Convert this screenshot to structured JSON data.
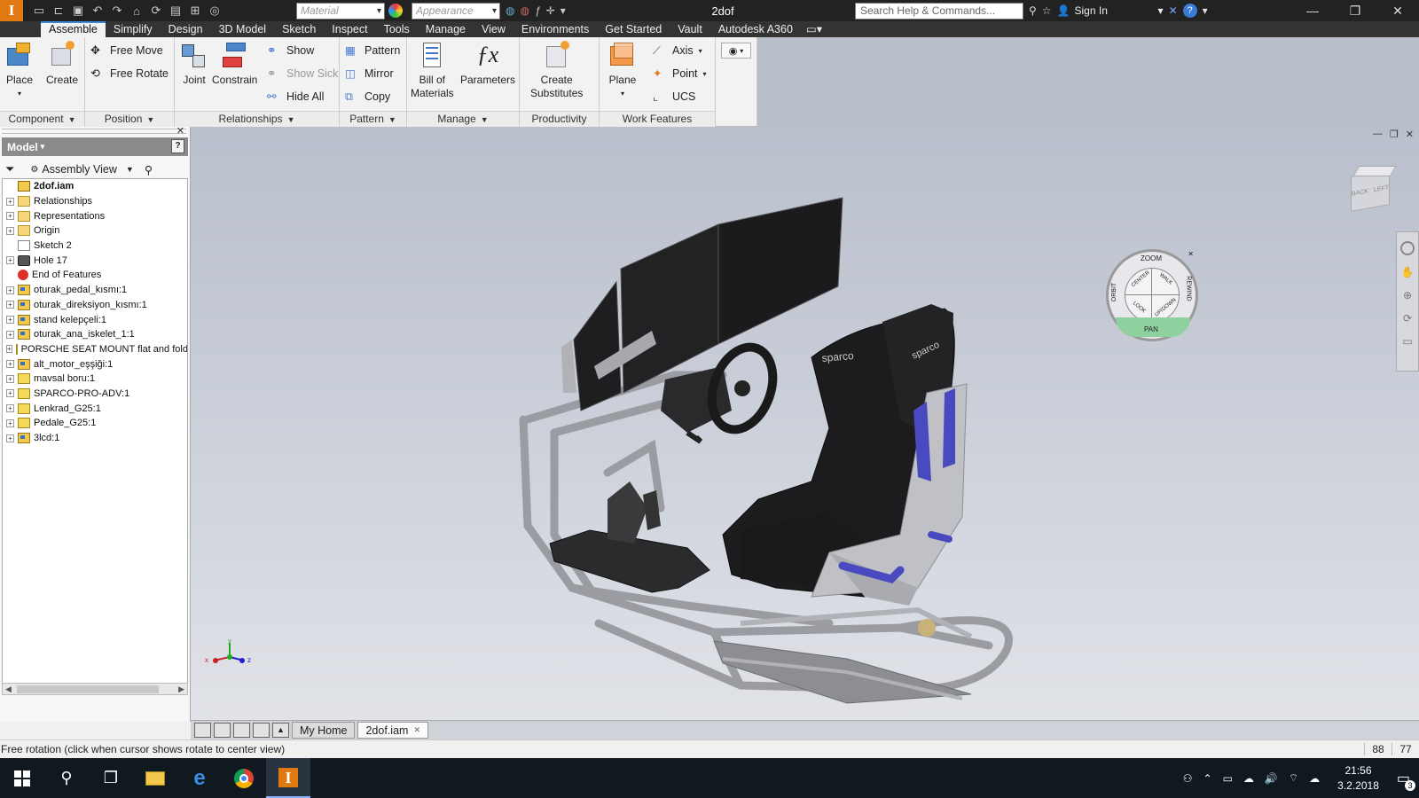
{
  "titlebar": {
    "app_letter": "I",
    "material_placeholder": "Material",
    "appearance_placeholder": "Appearance",
    "doc_title": "2dof",
    "search_placeholder": "Search Help & Commands...",
    "sign_in": "Sign In"
  },
  "ribbon": {
    "tabs": [
      "Assemble",
      "Simplify",
      "Design",
      "3D Model",
      "Sketch",
      "Inspect",
      "Tools",
      "Manage",
      "View",
      "Environments",
      "Get Started",
      "Vault",
      "Autodesk A360"
    ],
    "component": {
      "place": "Place",
      "create": "Create",
      "label": "Component"
    },
    "position": {
      "free_move": "Free Move",
      "free_rotate": "Free Rotate",
      "label": "Position"
    },
    "relationships": {
      "joint": "Joint",
      "constrain": "Constrain",
      "show": "Show",
      "show_sick": "Show Sick",
      "hide_all": "Hide All",
      "label": "Relationships"
    },
    "pattern": {
      "pattern": "Pattern",
      "mirror": "Mirror",
      "copy": "Copy",
      "label": "Pattern"
    },
    "manage": {
      "bom_line1": "Bill of",
      "bom_line2": "Materials",
      "parameters": "Parameters",
      "label": "Manage"
    },
    "productivity": {
      "create_line1": "Create",
      "create_line2": "Substitutes",
      "label": "Productivity"
    },
    "work_features": {
      "plane": "Plane",
      "axis": "Axis",
      "point": "Point",
      "ucs": "UCS",
      "label": "Work Features"
    }
  },
  "browser": {
    "header": "Model",
    "view_mode": "Assembly View",
    "tree": [
      {
        "label": "2dof.iam",
        "icon": "root",
        "expander": "none",
        "bold": true
      },
      {
        "label": "Relationships",
        "icon": "folder",
        "expander": "+"
      },
      {
        "label": "Representations",
        "icon": "folder",
        "expander": "+"
      },
      {
        "label": "Origin",
        "icon": "folder",
        "expander": "+"
      },
      {
        "label": "Sketch 2",
        "icon": "sketch",
        "expander": "none"
      },
      {
        "label": "Hole 17",
        "icon": "hole",
        "expander": "+"
      },
      {
        "label": "End of Features",
        "icon": "eof",
        "expander": "none"
      },
      {
        "label": "oturak_pedal_kısmı:1",
        "icon": "asm",
        "expander": "+"
      },
      {
        "label": "oturak_direksiyon_kısmı:1",
        "icon": "asm",
        "expander": "+"
      },
      {
        "label": "stand kelepçeli:1",
        "icon": "asm",
        "expander": "+"
      },
      {
        "label": "oturak_ana_iskelet_1:1",
        "icon": "asm",
        "expander": "+"
      },
      {
        "label": "PORSCHE SEAT MOUNT flat and fold",
        "icon": "part",
        "expander": "+"
      },
      {
        "label": "alt_motor_eşşiği:1",
        "icon": "asm",
        "expander": "+"
      },
      {
        "label": "mavsal boru:1",
        "icon": "part",
        "expander": "+"
      },
      {
        "label": "SPARCO-PRO-ADV:1",
        "icon": "part",
        "expander": "+"
      },
      {
        "label": "Lenkrad_G25:1",
        "icon": "part",
        "expander": "+"
      },
      {
        "label": "Pedale_G25:1",
        "icon": "part",
        "expander": "+"
      },
      {
        "label": "3lcd:1",
        "icon": "asm",
        "expander": "+"
      }
    ]
  },
  "navwheel": {
    "zoom": "ZOOM",
    "rewind": "REWIND",
    "pan": "PAN",
    "orbit": "ORBIT",
    "center": "CENTER",
    "walk": "WALK",
    "look": "LOOK",
    "up_down": "UP/DOWN"
  },
  "viewcube": {
    "back": "BACK",
    "left": "LEFT"
  },
  "seat_brand": "sparco",
  "doc_tabs": {
    "home": "My Home",
    "active": "2dof.iam"
  },
  "status": {
    "text": "Free rotation (click when cursor shows rotate to center view)",
    "num1": "88",
    "num2": "77"
  },
  "taskbar": {
    "time": "21:56",
    "date": "3.2.2018",
    "notifications": "3"
  }
}
